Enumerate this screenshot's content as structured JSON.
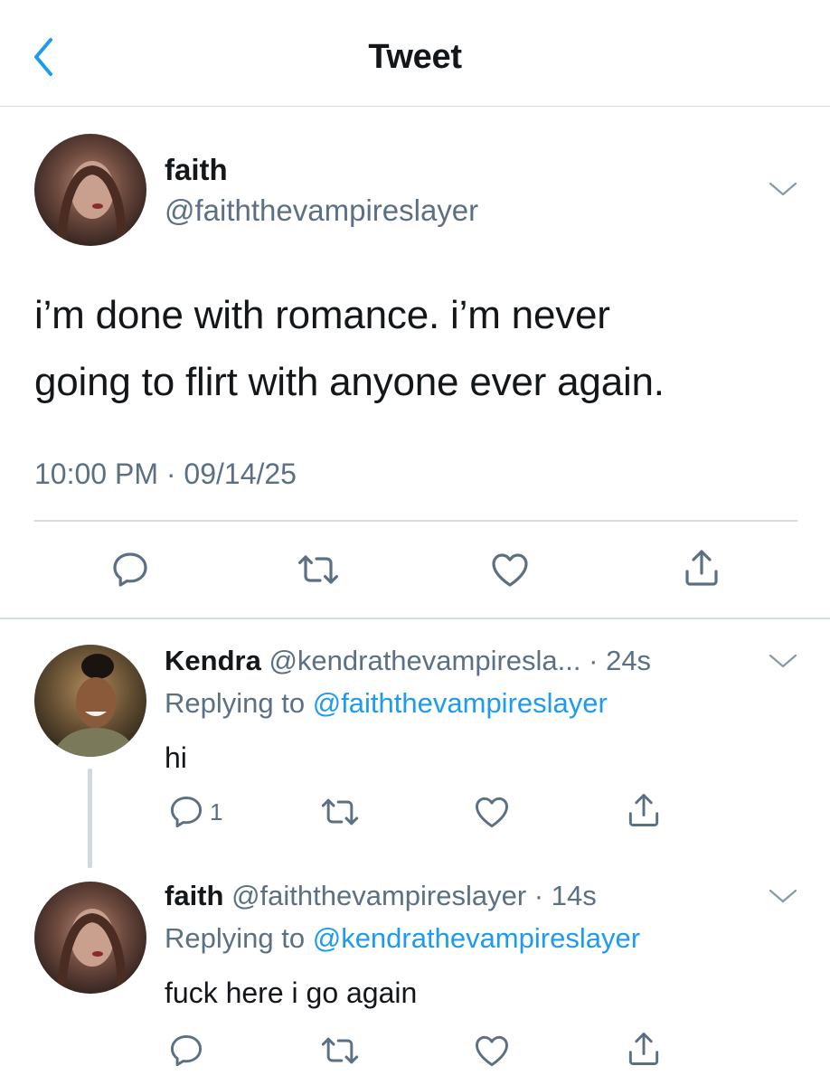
{
  "header": {
    "title": "Tweet"
  },
  "main_tweet": {
    "name": "faith",
    "handle": "@faiththevampireslayer",
    "text_lines": [
      "i’m done with romance. i’m never",
      "going to flirt with anyone ever again."
    ],
    "timestamp": "10:00 PM · 09/14/25"
  },
  "replies": [
    {
      "name": "Kendra",
      "handle": "@kendrathevampiresla...",
      "time": "· 24s",
      "replying_prefix": "Replying to",
      "replying_to": "@faiththevampireslayer",
      "text": "hi",
      "reply_count": "1"
    },
    {
      "name": "faith",
      "handle": "@faiththevampireslayer",
      "time": "· 14s",
      "replying_prefix": "Replying to",
      "replying_to": "@kendrathevampireslayer",
      "text": "fuck here i go again",
      "reply_count": ""
    }
  ],
  "colors": {
    "accent": "#1d9bf0",
    "text": "#14171a",
    "muted": "#5b7083",
    "divider": "#d4dde2"
  },
  "icons": [
    "chevron-left-icon",
    "chevron-down-icon",
    "reply-icon",
    "retweet-icon",
    "like-icon",
    "share-icon"
  ]
}
